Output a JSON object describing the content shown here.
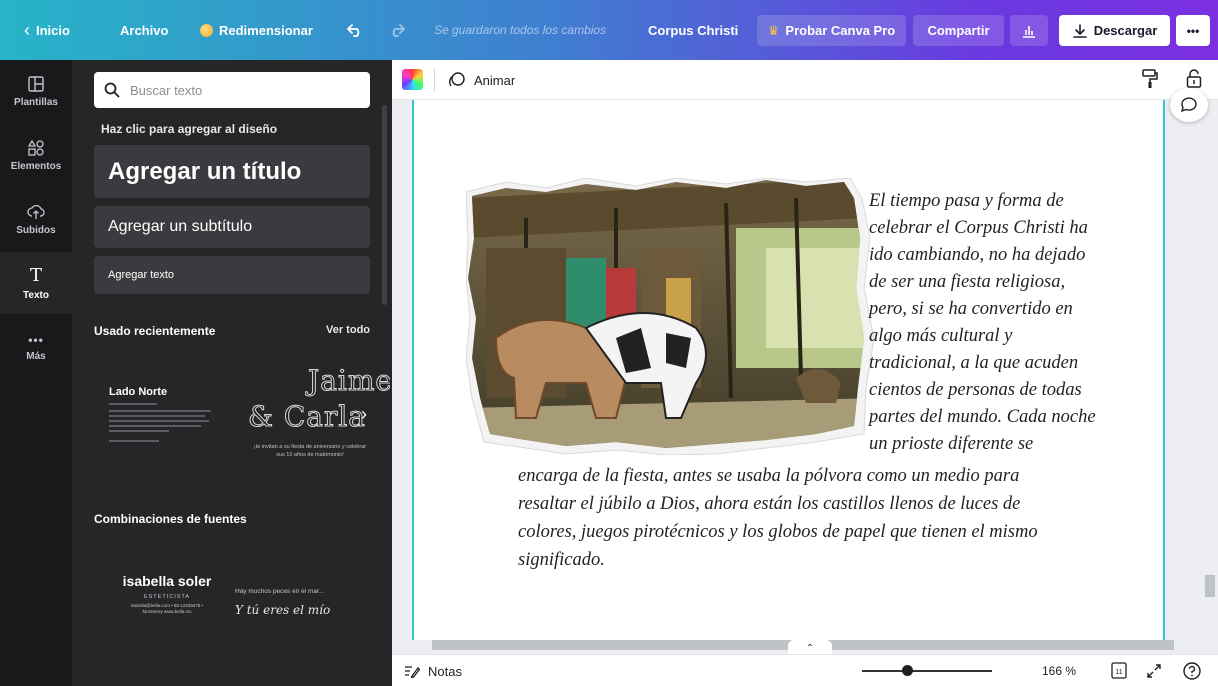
{
  "topbar": {
    "home_label": "Inicio",
    "file_label": "Archivo",
    "resize_label": "Redimensionar",
    "save_status": "Se guardaron todos los cambios",
    "doc_title": "Corpus Christi",
    "pro_label": "Probar Canva Pro",
    "share_label": "Compartir",
    "download_label": "Descargar",
    "more_label": "•••"
  },
  "rail": {
    "items": [
      {
        "label": "Plantillas",
        "icon": "templates-icon"
      },
      {
        "label": "Elementos",
        "icon": "elements-icon"
      },
      {
        "label": "Subidos",
        "icon": "upload-icon"
      },
      {
        "label": "Texto",
        "icon": "text-icon"
      },
      {
        "label": "Más",
        "icon": "more-icon"
      }
    ],
    "more_glyph": "•••",
    "text_glyph": "T"
  },
  "panel": {
    "search_placeholder": "Buscar texto",
    "hint": "Haz clic para agregar al diseño",
    "add_title": "Agregar un título",
    "add_subtitle": "Agregar un subtítulo",
    "add_text": "Agregar texto",
    "recent_title": "Usado recientemente",
    "see_all": "Ver todo",
    "tpl1_title": "Lado Norte",
    "tpl2_line1": "Jaime",
    "tpl2_line2": "& Carla",
    "tpl2_caption": "¡te invitan a su fiesta de aniversario y celebrar sus 10 años de matrimonio!",
    "combos_title": "Combinaciones de fuentes",
    "combo1_name": "isabella soler",
    "combo1_role": "ESTETICISTA",
    "combo1_contact": "isabella@bella.com • 55-12345678 • Monterrey www.bella.mx",
    "combo2_line1": "Hay muchos peces en el mar...",
    "combo2_line2": "Y tú eres el mío"
  },
  "editor": {
    "animate_label": "Animar",
    "paragraph_right": [
      "El tiempo pasa y forma de",
      "celebrar el Corpus Christi ha",
      "ido cambiando, no ha dejado",
      "de ser una fiesta religiosa,",
      "pero, si se ha convertido en",
      "algo más cultural y",
      "tradicional, a la que acuden",
      "cientos de personas de todas",
      "partes del mundo. Cada noche",
      "un prioste diferente se"
    ],
    "paragraph_bottom": [
      "encarga de la fiesta, antes se usaba la pólvora como un medio para",
      "resaltar el júbilo a Dios, ahora están los castillos llenos de luces de",
      "colores, juegos pirotécnicos y los globos de papel que tienen el mismo",
      "significado."
    ]
  },
  "bottombar": {
    "notes_label": "Notas",
    "zoom": "166 %",
    "zoom_value": 166,
    "page_count": "11"
  },
  "colors": {
    "gradient_start": "#27b4c8",
    "gradient_end": "#7b2fe0",
    "rail_bg": "#18191b",
    "panel_bg": "#252627",
    "page_border": "#38c6d6"
  }
}
